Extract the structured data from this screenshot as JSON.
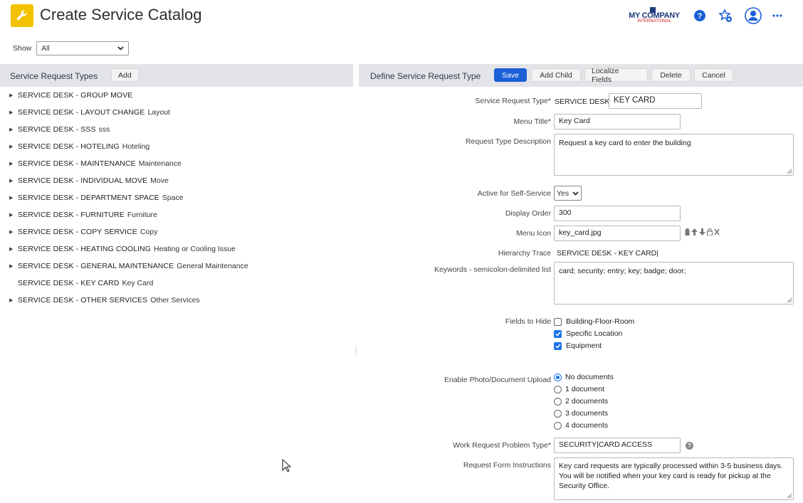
{
  "header": {
    "title": "Create Service Catalog",
    "app_icon": "wrench-icon",
    "logo": {
      "main": "MY COMPANY",
      "sub": "INTERNATIONAL"
    },
    "icons": [
      "help-icon",
      "favorite-add-icon",
      "user-avatar-icon",
      "more-icon"
    ]
  },
  "filter": {
    "label": "Show",
    "value": "All"
  },
  "left_panel": {
    "title": "Service Request Types",
    "add_label": "Add",
    "items": [
      {
        "name": "SERVICE DESK - GROUP MOVE",
        "sub": "",
        "expandable": true
      },
      {
        "name": "SERVICE DESK - LAYOUT CHANGE",
        "sub": "Layout",
        "expandable": true
      },
      {
        "name": "SERVICE DESK - SSS",
        "sub": "sss",
        "expandable": true
      },
      {
        "name": "SERVICE DESK - HOTELING",
        "sub": "Hoteling",
        "expandable": true
      },
      {
        "name": "SERVICE DESK - MAINTENANCE",
        "sub": "Maintenance",
        "expandable": true
      },
      {
        "name": "SERVICE DESK - INDIVIDUAL MOVE",
        "sub": "Move",
        "expandable": true
      },
      {
        "name": "SERVICE DESK - DEPARTMENT SPACE",
        "sub": "Space",
        "expandable": true
      },
      {
        "name": "SERVICE DESK - FURNITURE",
        "sub": "Furniture",
        "expandable": true
      },
      {
        "name": "SERVICE DESK - COPY SERVICE",
        "sub": "Copy",
        "expandable": true
      },
      {
        "name": "SERVICE DESK - HEATING COOLING",
        "sub": "Heating or Cooling Issue",
        "expandable": true
      },
      {
        "name": "SERVICE DESK - GENERAL MAINTENANCE",
        "sub": "General Maintenance",
        "expandable": true
      },
      {
        "name": "SERVICE DESK - KEY CARD",
        "sub": "Key Card",
        "expandable": false
      },
      {
        "name": "SERVICE DESK - OTHER SERVICES",
        "sub": "Other Services",
        "expandable": true
      }
    ]
  },
  "right_panel": {
    "title": "Define Service Request Type",
    "buttons": {
      "save": "Save",
      "add_child": "Add Child",
      "localize": "Localize Fields",
      "delete": "Delete",
      "cancel": "Cancel"
    },
    "fields": {
      "service_request_type": {
        "label": "Service Request Type*",
        "prefix": "SERVICE DESK -",
        "value": "KEY CARD"
      },
      "menu_title": {
        "label": "Menu Title*",
        "value": "Key Card"
      },
      "description": {
        "label": "Request Type Description",
        "value": "Request a key card to enter the building"
      },
      "active_self_service": {
        "label": "Active for Self-Service",
        "value": "Yes"
      },
      "display_order": {
        "label": "Display Order",
        "value": "300"
      },
      "menu_icon": {
        "label": "Menu Icon",
        "value": "key_card.jpg"
      },
      "hierarchy_trace": {
        "label": "Hierarchy Trace",
        "value": "SERVICE DESK - KEY CARD|"
      },
      "keywords": {
        "label": "Keywords - semicolon-delimited list",
        "value": "card; security; entry; key; badge; door;"
      },
      "fields_to_hide": {
        "label": "Fields to Hide",
        "options": [
          {
            "label": "Building-Floor-Room",
            "checked": false
          },
          {
            "label": "Specific Location",
            "checked": true
          },
          {
            "label": "Equipment",
            "checked": true
          }
        ]
      },
      "photo_upload": {
        "label": "Enable Photo/Document Upload",
        "options": [
          {
            "label": "No documents",
            "selected": true
          },
          {
            "label": "1 document",
            "selected": false
          },
          {
            "label": "2 documents",
            "selected": false
          },
          {
            "label": "3 documents",
            "selected": false
          },
          {
            "label": "4 documents",
            "selected": false
          }
        ]
      },
      "problem_type": {
        "label": "Work Request Problem Type*",
        "value": "SECURITY|CARD ACCESS"
      },
      "instructions": {
        "label": "Request Form Instructions",
        "value": "Key card requests are typically processed within 3-5 business days. You will be notified when your key card is ready for pickup at the Security Office."
      }
    }
  },
  "colors": {
    "accent": "#1a5fd6",
    "app_icon": "#f2c200",
    "panel_header": "#e2e4e8"
  }
}
